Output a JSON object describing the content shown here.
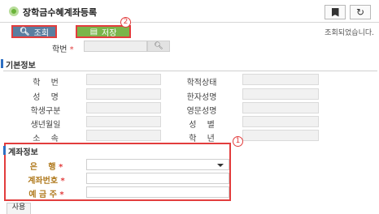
{
  "header": {
    "title": "장학금수혜계좌등록",
    "bookmark_icon": "bookmark-icon",
    "refresh_icon": "refresh-icon"
  },
  "toolbar": {
    "search_label": "조회",
    "save_label": "저장",
    "status_text": "조회되었습니다.",
    "callout_save": "2"
  },
  "lookup": {
    "student_id_label": "학번",
    "required_mark": "*"
  },
  "basic": {
    "section_title": "기본정보",
    "fields": {
      "grade": "학　 번",
      "academic_status": "학적상태",
      "name": "성　 명",
      "hanja_name": "한자성명",
      "student_type": "학생구분",
      "english_name": "영문성명",
      "birth_date": "생년월일",
      "gender": "성　 별",
      "department": "소　 속",
      "year": "학　 년"
    }
  },
  "account": {
    "section_title": "계좌정보",
    "callout": "1",
    "bank_label": "은　 행",
    "account_number_label": "계좌번호",
    "holder_label": "예 금 주",
    "required_mark": "*"
  },
  "footer": {
    "usage_label": "사용"
  }
}
